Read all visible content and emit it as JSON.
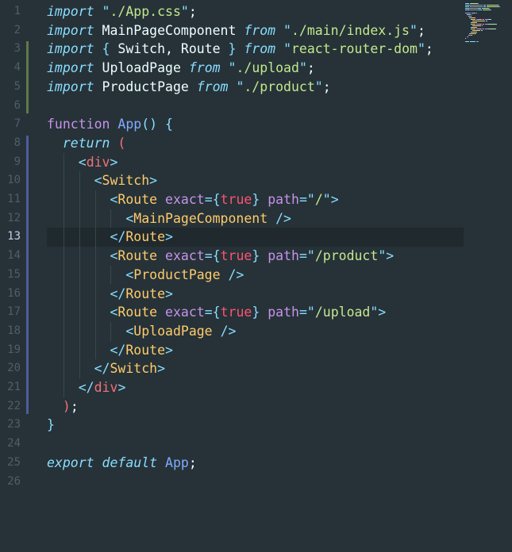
{
  "editor": {
    "active_line": 13,
    "lines": [
      {
        "n": "1",
        "tokens": [
          [
            "kw-i",
            "import"
          ],
          [
            "plain",
            " "
          ],
          [
            "punc",
            "\""
          ],
          [
            "str",
            "./App.css"
          ],
          [
            "punc",
            "\""
          ],
          [
            "plain",
            ";"
          ]
        ]
      },
      {
        "n": "2",
        "tokens": [
          [
            "kw-i",
            "import"
          ],
          [
            "plain",
            " MainPageComponent "
          ],
          [
            "kw-i",
            "from"
          ],
          [
            "plain",
            " "
          ],
          [
            "punc",
            "\""
          ],
          [
            "str",
            "./main/index.js"
          ],
          [
            "punc",
            "\""
          ],
          [
            "plain",
            ";"
          ]
        ]
      },
      {
        "n": "3",
        "tokens": [
          [
            "kw-i",
            "import"
          ],
          [
            "plain",
            " "
          ],
          [
            "brace",
            "{"
          ],
          [
            "plain",
            " Switch, Route "
          ],
          [
            "brace",
            "}"
          ],
          [
            "plain",
            " "
          ],
          [
            "kw-i",
            "from"
          ],
          [
            "plain",
            " "
          ],
          [
            "punc",
            "\""
          ],
          [
            "str",
            "react-router-dom"
          ],
          [
            "punc",
            "\""
          ],
          [
            "plain",
            ";"
          ]
        ]
      },
      {
        "n": "4",
        "tokens": [
          [
            "kw-i",
            "import"
          ],
          [
            "plain",
            " UploadPage "
          ],
          [
            "kw-i",
            "from"
          ],
          [
            "plain",
            " "
          ],
          [
            "punc",
            "\""
          ],
          [
            "str",
            "./upload"
          ],
          [
            "punc",
            "\""
          ],
          [
            "plain",
            ";"
          ]
        ]
      },
      {
        "n": "5",
        "tokens": [
          [
            "kw-i",
            "import"
          ],
          [
            "plain",
            " ProductPage "
          ],
          [
            "kw-i",
            "from"
          ],
          [
            "plain",
            " "
          ],
          [
            "punc",
            "\""
          ],
          [
            "str",
            "./product"
          ],
          [
            "punc",
            "\""
          ],
          [
            "plain",
            ";"
          ]
        ]
      },
      {
        "n": "6",
        "tokens": []
      },
      {
        "n": "7",
        "tokens": [
          [
            "kw",
            "function"
          ],
          [
            "plain",
            " "
          ],
          [
            "fn",
            "App"
          ],
          [
            "punc",
            "()"
          ],
          [
            "plain",
            " "
          ],
          [
            "punc",
            "{"
          ]
        ]
      },
      {
        "n": "8",
        "tokens": [
          [
            "plain",
            "  "
          ],
          [
            "kw-i",
            "return"
          ],
          [
            "plain",
            " "
          ],
          [
            "tag",
            "("
          ]
        ]
      },
      {
        "n": "9",
        "tokens": [
          [
            "plain",
            "    "
          ],
          [
            "punc",
            "<"
          ],
          [
            "tag",
            "div"
          ],
          [
            "punc",
            ">"
          ]
        ]
      },
      {
        "n": "10",
        "tokens": [
          [
            "plain",
            "      "
          ],
          [
            "punc",
            "<"
          ],
          [
            "comp",
            "Switch"
          ],
          [
            "punc",
            ">"
          ]
        ]
      },
      {
        "n": "11",
        "tokens": [
          [
            "plain",
            "        "
          ],
          [
            "punc",
            "<"
          ],
          [
            "comp",
            "Route"
          ],
          [
            "plain",
            " "
          ],
          [
            "attr",
            "exact"
          ],
          [
            "punc",
            "={"
          ],
          [
            "bool",
            "true"
          ],
          [
            "punc",
            "}"
          ],
          [
            "plain",
            " "
          ],
          [
            "attr",
            "path"
          ],
          [
            "punc",
            "=\""
          ],
          [
            "str",
            "/"
          ],
          [
            "punc",
            "\">"
          ]
        ]
      },
      {
        "n": "12",
        "tokens": [
          [
            "plain",
            "          "
          ],
          [
            "punc",
            "<"
          ],
          [
            "comp",
            "MainPageComponent"
          ],
          [
            "plain",
            " "
          ],
          [
            "punc",
            "/>"
          ]
        ]
      },
      {
        "n": "13",
        "tokens": [
          [
            "plain",
            "        "
          ],
          [
            "punc",
            "</"
          ],
          [
            "comp",
            "Route"
          ],
          [
            "punc",
            ">"
          ]
        ]
      },
      {
        "n": "14",
        "tokens": [
          [
            "plain",
            "        "
          ],
          [
            "punc",
            "<"
          ],
          [
            "comp",
            "Route"
          ],
          [
            "plain",
            " "
          ],
          [
            "attr",
            "exact"
          ],
          [
            "punc",
            "={"
          ],
          [
            "bool",
            "true"
          ],
          [
            "punc",
            "}"
          ],
          [
            "plain",
            " "
          ],
          [
            "attr",
            "path"
          ],
          [
            "punc",
            "=\""
          ],
          [
            "str",
            "/product"
          ],
          [
            "punc",
            "\">"
          ]
        ]
      },
      {
        "n": "15",
        "tokens": [
          [
            "plain",
            "          "
          ],
          [
            "punc",
            "<"
          ],
          [
            "comp",
            "ProductPage"
          ],
          [
            "plain",
            " "
          ],
          [
            "punc",
            "/>"
          ]
        ]
      },
      {
        "n": "16",
        "tokens": [
          [
            "plain",
            "        "
          ],
          [
            "punc",
            "</"
          ],
          [
            "comp",
            "Route"
          ],
          [
            "punc",
            ">"
          ]
        ]
      },
      {
        "n": "17",
        "tokens": [
          [
            "plain",
            "        "
          ],
          [
            "punc",
            "<"
          ],
          [
            "comp",
            "Route"
          ],
          [
            "plain",
            " "
          ],
          [
            "attr",
            "exact"
          ],
          [
            "punc",
            "={"
          ],
          [
            "bool",
            "true"
          ],
          [
            "punc",
            "}"
          ],
          [
            "plain",
            " "
          ],
          [
            "attr",
            "path"
          ],
          [
            "punc",
            "=\""
          ],
          [
            "str",
            "/upload"
          ],
          [
            "punc",
            "\">"
          ]
        ]
      },
      {
        "n": "18",
        "tokens": [
          [
            "plain",
            "          "
          ],
          [
            "punc",
            "<"
          ],
          [
            "comp",
            "UploadPage"
          ],
          [
            "plain",
            " "
          ],
          [
            "punc",
            "/>"
          ]
        ]
      },
      {
        "n": "19",
        "tokens": [
          [
            "plain",
            "        "
          ],
          [
            "punc",
            "</"
          ],
          [
            "comp",
            "Route"
          ],
          [
            "punc",
            ">"
          ]
        ]
      },
      {
        "n": "20",
        "tokens": [
          [
            "plain",
            "      "
          ],
          [
            "punc",
            "</"
          ],
          [
            "comp",
            "Switch"
          ],
          [
            "punc",
            ">"
          ]
        ]
      },
      {
        "n": "21",
        "tokens": [
          [
            "plain",
            "    "
          ],
          [
            "punc",
            "</"
          ],
          [
            "tag",
            "div"
          ],
          [
            "punc",
            ">"
          ]
        ]
      },
      {
        "n": "22",
        "tokens": [
          [
            "plain",
            "  "
          ],
          [
            "tag",
            ")"
          ],
          [
            "plain",
            ";"
          ]
        ]
      },
      {
        "n": "23",
        "tokens": [
          [
            "punc",
            "}"
          ]
        ]
      },
      {
        "n": "24",
        "tokens": []
      },
      {
        "n": "25",
        "tokens": [
          [
            "kw-i",
            "export"
          ],
          [
            "plain",
            " "
          ],
          [
            "kw-i",
            "default"
          ],
          [
            "plain",
            " "
          ],
          [
            "fn",
            "App"
          ],
          [
            "plain",
            ";"
          ]
        ]
      },
      {
        "n": "26",
        "tokens": []
      }
    ]
  },
  "colors": {
    "background": "#263238",
    "current_line": "#1f292e",
    "git_added": "#5f7a4a",
    "git_modified": "#4e5d9a"
  }
}
